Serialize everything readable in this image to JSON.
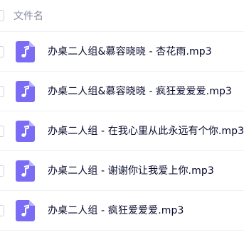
{
  "header": {
    "column_label": "文件名"
  },
  "files": [
    {
      "name": "办桌二人组&慕容晓晓 - 杏花雨.mp3",
      "icon": "music-file-icon"
    },
    {
      "name": "办桌二人组&慕容晓晓 - 疯狂爱爱爱.mp3",
      "icon": "music-file-icon"
    },
    {
      "name": "办桌二人组 - 在我心里从此永远有个你.mp3",
      "icon": "music-file-icon"
    },
    {
      "name": "办桌二人组 - 谢谢你让我爱上你.mp3",
      "icon": "music-file-icon"
    },
    {
      "name": "办桌二人组 - 疯狂爱爱爱.mp3",
      "icon": "music-file-icon"
    }
  ],
  "colors": {
    "icon_fill": "#7b6cf6",
    "icon_fold": "#b7afff",
    "header_text": "#878c9c",
    "name_text": "#06092c",
    "divider": "#eef0f4"
  }
}
